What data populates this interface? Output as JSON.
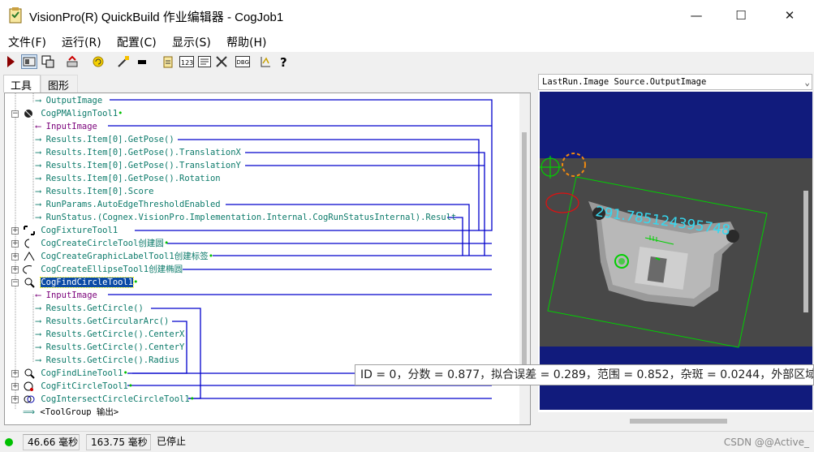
{
  "window": {
    "title": "VisionPro(R) QuickBuild 作业编辑器 - CogJob1",
    "minimize_glyph": "—",
    "maximize_glyph": "☐",
    "close_glyph": "✕"
  },
  "menu": [
    {
      "label": "文件(F)"
    },
    {
      "label": "运行(R)"
    },
    {
      "label": "配置(C)"
    },
    {
      "label": "显示(S)"
    },
    {
      "label": "帮助(H)"
    }
  ],
  "toolbar_icons": [
    "run-icon",
    "run-once-icon",
    "view-icon",
    "reset-icon",
    "loop-icon",
    "wand-icon",
    "stop-icon",
    "edit-icon",
    "number-icon",
    "display-icon",
    "tools-icon",
    "document-icon",
    "debug-icon",
    "align-icon",
    "help-icon"
  ],
  "tabs": [
    {
      "label": "工具",
      "active": true
    },
    {
      "label": "图形",
      "active": false
    }
  ],
  "tree": [
    {
      "text": "OutputImage",
      "kind": "output"
    },
    {
      "text": "CogPMAlignTool1",
      "kind": "tool"
    },
    {
      "text": "InputImage",
      "kind": "input"
    },
    {
      "text": "Results.Item[0].GetPose()",
      "kind": "output"
    },
    {
      "text": "Results.Item[0].GetPose().TranslationX",
      "kind": "output"
    },
    {
      "text": "Results.Item[0].GetPose().TranslationY",
      "kind": "output"
    },
    {
      "text": "Results.Item[0].GetPose().Rotation",
      "kind": "output"
    },
    {
      "text": "Results.Item[0].Score",
      "kind": "output"
    },
    {
      "text": "RunParams.AutoEdgeThresholdEnabled",
      "kind": "output"
    },
    {
      "text": "RunStatus.(Cognex.VisionPro.Implementation.Internal.CogRunStatusInternal).Result",
      "kind": "output"
    },
    {
      "text": "CogFixtureTool1",
      "kind": "tool"
    },
    {
      "text": "CogCreateCircleTool创建圆",
      "kind": "tool"
    },
    {
      "text": "CogCreateGraphicLabelTool1创建标签",
      "kind": "tool"
    },
    {
      "text": "CogCreateEllipseTool1创建椭圆",
      "kind": "tool"
    },
    {
      "text": "CogFindCircleTool1",
      "kind": "tool",
      "selected": true
    },
    {
      "text": "InputImage",
      "kind": "input"
    },
    {
      "text": "Results.GetCircle()",
      "kind": "output"
    },
    {
      "text": "Results.GetCircularArc()",
      "kind": "output"
    },
    {
      "text": "Results.GetCircle().CenterX",
      "kind": "output"
    },
    {
      "text": "Results.GetCircle().CenterY",
      "kind": "output"
    },
    {
      "text": "Results.GetCircle().Radius",
      "kind": "output"
    },
    {
      "text": "CogFindLineTool1",
      "kind": "tool"
    },
    {
      "text": "CogFitCircleTool1",
      "kind": "tool"
    },
    {
      "text": "CogIntersectCircleCircleTool1",
      "kind": "tool"
    },
    {
      "text": "<ToolGroup 输出>",
      "kind": "group-output"
    }
  ],
  "image_view": {
    "source": "LastRun.Image Source.OutputImage",
    "label_value": "291.785124395748"
  },
  "tooltip": "ID = 0，分数 = 0.877，拟合误差 = 0.289，范围 = 0.852，杂斑 = 0.0244，外部区域",
  "status": {
    "time1": "46.66 毫秒",
    "time2": "163.75 毫秒",
    "state": "已停止",
    "watermark": "CSDN @@Active_"
  },
  "colors": {
    "tree_green": "#0b7a6a",
    "tree_purple": "#7a007a",
    "link_blue": "#0000cc",
    "canvas_bg": "#111b7c",
    "graphic_green": "#00d000",
    "graphic_cyan": "#35d8f0",
    "graphic_orange": "#f08a10",
    "graphic_red": "#e01010"
  }
}
